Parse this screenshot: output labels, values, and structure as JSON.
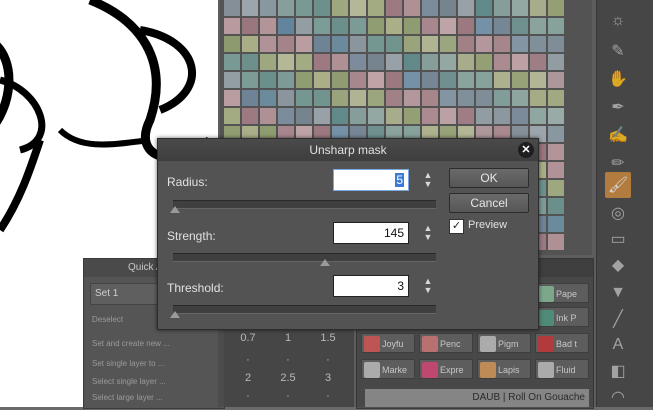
{
  "dialog": {
    "title": "Unsharp mask",
    "params": [
      {
        "label": "Radius:",
        "value": "5",
        "level": 0.0
      },
      {
        "label": "Strength:",
        "value": "145",
        "level": 0.57
      },
      {
        "label": "Threshold:",
        "value": "3",
        "level": 0.0
      }
    ],
    "ok_label": "OK",
    "cancel_label": "Cancel",
    "preview_label": "Preview",
    "preview_checked": true
  },
  "quick_access": {
    "title": "Quick A",
    "set_value": "Set 1",
    "rows": [
      "Deselect",
      "Set and create new ...",
      "Set single layer to ...",
      "Select single layer ...",
      "Select large layer ..."
    ]
  },
  "brush_sizes": [
    "0.7",
    "1",
    "1.5",
    "·",
    "·",
    "·",
    "2",
    "2.5",
    "3",
    "·",
    "·",
    "·"
  ],
  "sub_tools": [
    {
      "label": "Pape",
      "color": "#8fc4a2"
    },
    {
      "label": "Ink P",
      "color": "#5aa08a"
    },
    {
      "label": "Joyfu",
      "color": "#e06060"
    },
    {
      "label": "Penc",
      "color": "#d98080"
    },
    {
      "label": "Pigm",
      "color": "#c8c8c8"
    },
    {
      "label": "Bad t",
      "color": "#d04040"
    },
    {
      "label": "Marke",
      "color": "#c8c8c8"
    },
    {
      "label": "Expre",
      "color": "#e05080"
    },
    {
      "label": "Lapis",
      "color": "#e0a060"
    },
    {
      "label": "Fluid",
      "color": "#c8c8c8"
    }
  ],
  "sub_tool_footer": "DAUB | Roll On Gouache",
  "colors": {
    "accent": "#d08f44",
    "dialog_bg": "#535353",
    "selection": "#3b7bd6"
  },
  "toolbar_icons": [
    "sun-icon",
    "eyedropper-icon",
    "hand-icon",
    "pen-icon",
    "brush-icon",
    "airbrush-icon",
    "eraser-icon",
    "fill-icon",
    "line-icon",
    "text-icon",
    "gradient-icon"
  ]
}
